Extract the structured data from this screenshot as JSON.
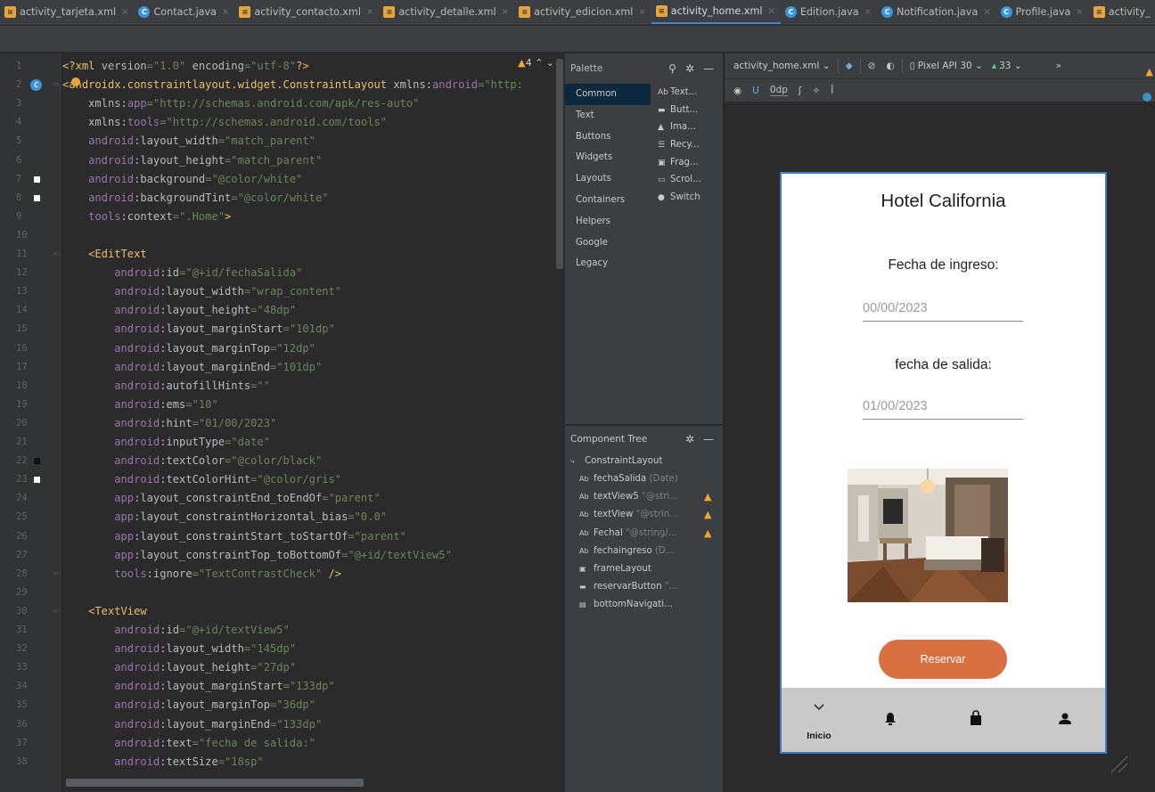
{
  "tabs": [
    {
      "label": "activity_tarjeta.xml",
      "kind": "xml",
      "active": false
    },
    {
      "label": "Contact.java",
      "kind": "java",
      "active": false
    },
    {
      "label": "activity_contacto.xml",
      "kind": "xml",
      "active": false
    },
    {
      "label": "activity_detalle.xml",
      "kind": "xml",
      "active": false
    },
    {
      "label": "activity_edicion.xml",
      "kind": "xml",
      "active": false
    },
    {
      "label": "activity_home.xml",
      "kind": "xml",
      "active": true
    },
    {
      "label": "Edition.java",
      "kind": "java",
      "active": false
    },
    {
      "label": "Notification.java",
      "kind": "java",
      "active": false
    },
    {
      "label": "Profile.java",
      "kind": "java",
      "active": false
    },
    {
      "label": "activity_",
      "kind": "xml",
      "active": false
    }
  ],
  "editor": {
    "warnings_count": "4",
    "line_numbers": [
      "1",
      "2",
      "3",
      "4",
      "5",
      "6",
      "7",
      "8",
      "9",
      "10",
      "11",
      "12",
      "13",
      "14",
      "15",
      "16",
      "17",
      "18",
      "19",
      "20",
      "21",
      "22",
      "23",
      "24",
      "25",
      "26",
      "27",
      "28",
      "29",
      "30",
      "31",
      "32",
      "33",
      "34",
      "35",
      "36",
      "37",
      "38"
    ],
    "lines": [
      [
        [
          "tg",
          "<?xml "
        ],
        [
          "at",
          "version"
        ],
        [
          "vl",
          "=\"1.0\" "
        ],
        [
          "at",
          "encoding"
        ],
        [
          "vl",
          "=\"utf-8\""
        ],
        [
          "tg",
          "?>"
        ]
      ],
      [
        [
          "tg",
          "<androidx.constraintlayout.widget.ConstraintLayout "
        ],
        [
          "at",
          "xmlns:"
        ],
        [
          "ns",
          "android"
        ],
        [
          "vl",
          "=\"http:"
        ]
      ],
      [
        [
          "at",
          "    xmlns:"
        ],
        [
          "ns",
          "app"
        ],
        [
          "vl",
          "=\"http://schemas.android.com/apk/res-auto\""
        ]
      ],
      [
        [
          "at",
          "    xmlns:"
        ],
        [
          "ns",
          "tools"
        ],
        [
          "vl",
          "=\"http://schemas.android.com/tools\""
        ]
      ],
      [
        [
          "ns",
          "    android"
        ],
        [
          "at",
          ":layout_width"
        ],
        [
          "vl",
          "=\"match_parent\""
        ]
      ],
      [
        [
          "ns",
          "    android"
        ],
        [
          "at",
          ":layout_height"
        ],
        [
          "vl",
          "=\"match_parent\""
        ]
      ],
      [
        [
          "ns",
          "    android"
        ],
        [
          "at",
          ":background"
        ],
        [
          "vl",
          "=\"@color/white\""
        ]
      ],
      [
        [
          "ns",
          "    android"
        ],
        [
          "at",
          ":backgroundTint"
        ],
        [
          "vl",
          "=\"@color/white\""
        ]
      ],
      [
        [
          "ns",
          "    tools"
        ],
        [
          "at",
          ":context"
        ],
        [
          "vl",
          "=\".Home\""
        ],
        [
          "tg",
          ">"
        ]
      ],
      [],
      [
        [
          "tg",
          "    <EditText"
        ]
      ],
      [
        [
          "ns",
          "        android"
        ],
        [
          "at",
          ":id"
        ],
        [
          "vl",
          "=\"@+id/fechaSalida\""
        ]
      ],
      [
        [
          "ns",
          "        android"
        ],
        [
          "at",
          ":layout_width"
        ],
        [
          "vl",
          "=\"wrap_content\""
        ]
      ],
      [
        [
          "ns",
          "        android"
        ],
        [
          "at",
          ":layout_height"
        ],
        [
          "vl",
          "=\"48dp\""
        ]
      ],
      [
        [
          "ns",
          "        android"
        ],
        [
          "at",
          ":layout_marginStart"
        ],
        [
          "vl",
          "=\"101dp\""
        ]
      ],
      [
        [
          "ns",
          "        android"
        ],
        [
          "at",
          ":layout_marginTop"
        ],
        [
          "vl",
          "=\"12dp\""
        ]
      ],
      [
        [
          "ns",
          "        android"
        ],
        [
          "at",
          ":layout_marginEnd"
        ],
        [
          "vl",
          "=\"101dp\""
        ]
      ],
      [
        [
          "ns",
          "        android"
        ],
        [
          "at",
          ":autofillHints"
        ],
        [
          "vl",
          "=\"\""
        ]
      ],
      [
        [
          "ns",
          "        android"
        ],
        [
          "at",
          ":ems"
        ],
        [
          "vl",
          "=\"10\""
        ]
      ],
      [
        [
          "ns",
          "        android"
        ],
        [
          "at",
          ":hint"
        ],
        [
          "vl",
          "=\"01/00/2023\""
        ]
      ],
      [
        [
          "ns",
          "        android"
        ],
        [
          "at",
          ":inputType"
        ],
        [
          "vl",
          "=\"date\""
        ]
      ],
      [
        [
          "ns",
          "        android"
        ],
        [
          "at",
          ":textColor"
        ],
        [
          "vl",
          "=\"@color/black\""
        ]
      ],
      [
        [
          "ns",
          "        android"
        ],
        [
          "at",
          ":textColorHint"
        ],
        [
          "vl",
          "=\"@color/gris\""
        ]
      ],
      [
        [
          "ns",
          "        app"
        ],
        [
          "at",
          ":layout_constraintEnd_toEndOf"
        ],
        [
          "vl",
          "=\"parent\""
        ]
      ],
      [
        [
          "ns",
          "        app"
        ],
        [
          "at",
          ":layout_constraintHorizontal_bias"
        ],
        [
          "vl",
          "=\"0.0\""
        ]
      ],
      [
        [
          "ns",
          "        app"
        ],
        [
          "at",
          ":layout_constraintStart_toStartOf"
        ],
        [
          "vl",
          "=\"parent\""
        ]
      ],
      [
        [
          "ns",
          "        app"
        ],
        [
          "at",
          ":layout_constraintTop_toBottomOf"
        ],
        [
          "vl",
          "=\"@+id/textView5\""
        ]
      ],
      [
        [
          "ns",
          "        tools"
        ],
        [
          "at",
          ":ignore"
        ],
        [
          "vl",
          "=\"TextContrastCheck\" "
        ],
        [
          "tg",
          "/>"
        ]
      ],
      [],
      [
        [
          "tg",
          "    <TextView"
        ]
      ],
      [
        [
          "ns",
          "        android"
        ],
        [
          "at",
          ":id"
        ],
        [
          "vl",
          "=\"@+id/textView5\""
        ]
      ],
      [
        [
          "ns",
          "        android"
        ],
        [
          "at",
          ":layout_width"
        ],
        [
          "vl",
          "=\"145dp\""
        ]
      ],
      [
        [
          "ns",
          "        android"
        ],
        [
          "at",
          ":layout_height"
        ],
        [
          "vl",
          "=\"27dp\""
        ]
      ],
      [
        [
          "ns",
          "        android"
        ],
        [
          "at",
          ":layout_marginStart"
        ],
        [
          "vl",
          "=\"133dp\""
        ]
      ],
      [
        [
          "ns",
          "        android"
        ],
        [
          "at",
          ":layout_marginTop"
        ],
        [
          "vl",
          "=\"36dp\""
        ]
      ],
      [
        [
          "ns",
          "        android"
        ],
        [
          "at",
          ":layout_marginEnd"
        ],
        [
          "vl",
          "=\"133dp\""
        ]
      ],
      [
        [
          "ns",
          "        android"
        ],
        [
          "at",
          ":text"
        ],
        [
          "vl",
          "=\"fecha de salida:\""
        ]
      ],
      [
        [
          "ns",
          "        android"
        ],
        [
          "at",
          ":textSize"
        ],
        [
          "vl",
          "=\"18sp\""
        ]
      ]
    ],
    "gutter_markers": {
      "2": "class-badge",
      "7": "white",
      "8": "white",
      "22": "black",
      "23": "white"
    },
    "fold_lines": [
      "2",
      "11",
      "28",
      "30"
    ]
  },
  "palette": {
    "title": "Palette",
    "categories": [
      "Common",
      "Text",
      "Buttons",
      "Widgets",
      "Layouts",
      "Containers",
      "Helpers",
      "Google",
      "Legacy"
    ],
    "selected_category": "Common",
    "items": [
      {
        "icon": "Ab",
        "label": "Text..."
      },
      {
        "icon": "▬",
        "label": "Butt..."
      },
      {
        "icon": "▲",
        "label": "Ima..."
      },
      {
        "icon": "☰",
        "label": "Recy..."
      },
      {
        "icon": "▣",
        "label": "Frag..."
      },
      {
        "icon": "▭",
        "label": "Scrol..."
      },
      {
        "icon": "●",
        "label": "Switch"
      }
    ]
  },
  "component_tree": {
    "title": "Component Tree",
    "root": "ConstraintLayout",
    "nodes": [
      {
        "icon": "Ab",
        "name": "fechaSalida",
        "detail": "(Date)",
        "warning": false
      },
      {
        "icon": "Ab",
        "name": "textView5",
        "detail": "\"@stri...",
        "warning": true
      },
      {
        "icon": "Ab",
        "name": "textView",
        "detail": "\"@strin...",
        "warning": true
      },
      {
        "icon": "Ab",
        "name": "FechaI",
        "detail": "\"@string/...",
        "warning": true
      },
      {
        "icon": "Ab",
        "name": "fechaingreso",
        "detail": "(D...",
        "warning": false
      },
      {
        "icon": "▣",
        "name": "frameLayout",
        "detail": "",
        "warning": false
      },
      {
        "icon": "▬",
        "name": "reservarButton",
        "detail": "\"...",
        "warning": false
      },
      {
        "icon": "▤",
        "name": "bottomNavigati...",
        "detail": "",
        "warning": false
      }
    ]
  },
  "design_toolbar": {
    "file": "activity_home.xml",
    "device": "Pixel API 30",
    "api": "33",
    "margin": "0dp"
  },
  "phone": {
    "title": "Hotel California",
    "label_ingreso": "Fecha de ingreso:",
    "input_ingreso": "00/00/2023",
    "label_salida": "fecha de salida:",
    "input_salida": "01/00/2023",
    "button": "Reservar",
    "nav": {
      "home_label": "Inicio"
    }
  },
  "colors": {
    "accent": "#4a88c7",
    "button": "#d97042",
    "warning": "#f0a732",
    "nav_bg": "#c9c9c9"
  }
}
